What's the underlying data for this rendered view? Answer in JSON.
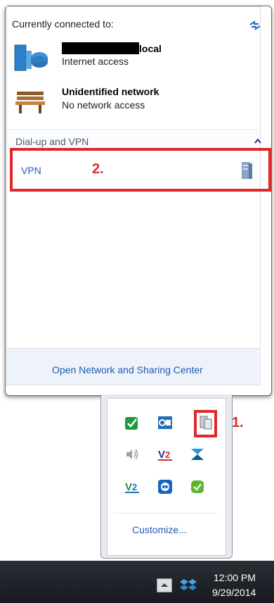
{
  "flyout": {
    "header": "Currently connected to:",
    "networks": [
      {
        "name_suffix": "local",
        "status": "Internet access",
        "icon": "domain-network-icon"
      },
      {
        "name": "Unidentified network",
        "status": "No network access",
        "icon": "park-bench-network-icon"
      }
    ],
    "section_label": "Dial-up and VPN",
    "vpn": {
      "label": "VPN",
      "icon": "vpn-server-icon"
    },
    "footer_link": "Open Network and Sharing Center"
  },
  "annotations": {
    "step1": "1.",
    "step2": "2.",
    "highlight_color": "#e0282b"
  },
  "tray": {
    "icons": [
      "sync-check-icon",
      "outlook-icon",
      "network-icon",
      "speaker-icon",
      "v2-icon",
      "arrow-app-icon",
      "v2-icon",
      "teamviewer-icon",
      "green-app-icon"
    ],
    "customize_label": "Customize..."
  },
  "taskbar": {
    "time": "12:00 PM",
    "date": "9/29/2014"
  },
  "colors": {
    "link": "#1f5bb3",
    "taskbar": "#1e2228"
  }
}
